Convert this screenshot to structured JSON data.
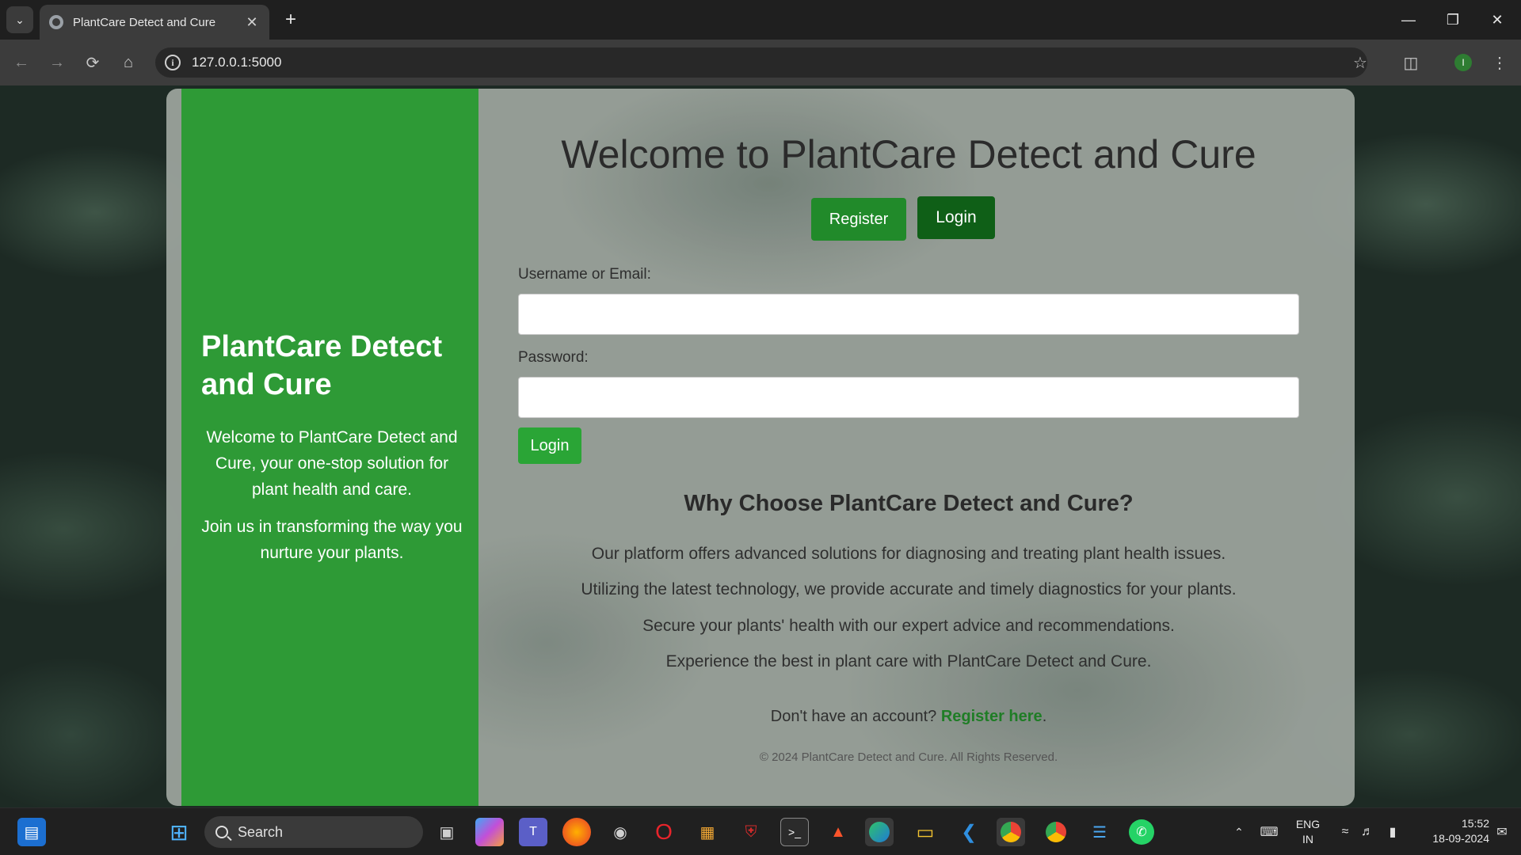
{
  "browser": {
    "tab_title": "PlantCare Detect and Cure",
    "close_glyph": "✕",
    "new_tab_glyph": "+",
    "url": "127.0.0.1:5000",
    "profile_initial": "I"
  },
  "sidebar": {
    "title": "PlantCare Detect and Cure",
    "intro": "Welcome to PlantCare Detect and Cure, your one-stop solution for plant health and care.",
    "join": "Join us in transforming the way you nurture your plants."
  },
  "main": {
    "heading": "Welcome to PlantCare Detect and Cure",
    "register_button": "Register",
    "login_tab_button": "Login",
    "username_label": "Username or Email:",
    "username_value": "",
    "password_label": "Password:",
    "password_value": "",
    "submit_button": "Login",
    "why_heading": "Why Choose PlantCare Detect and Cure?",
    "features": [
      "Our platform offers advanced solutions for diagnosing and treating plant health issues.",
      "Utilizing the latest technology, we provide accurate and timely diagnostics for your plants.",
      "Secure your plants' health with our expert advice and recommendations.",
      "Experience the best in plant care with PlantCare Detect and Cure."
    ],
    "account_prompt": "Don't have an account?",
    "register_link": "Register here",
    "account_suffix": ".",
    "footer": "© 2024 PlantCare Detect and Cure. All Rights Reserved."
  },
  "taskbar": {
    "search_label": "Search",
    "language": "ENG",
    "region": "IN",
    "time": "15:52",
    "date": "18-09-2024"
  },
  "colors": {
    "sidebar_green": "#2e9a36",
    "register_green": "#218a2a",
    "login_dark_green": "#0f5f17",
    "link_green": "#1f7d26"
  }
}
